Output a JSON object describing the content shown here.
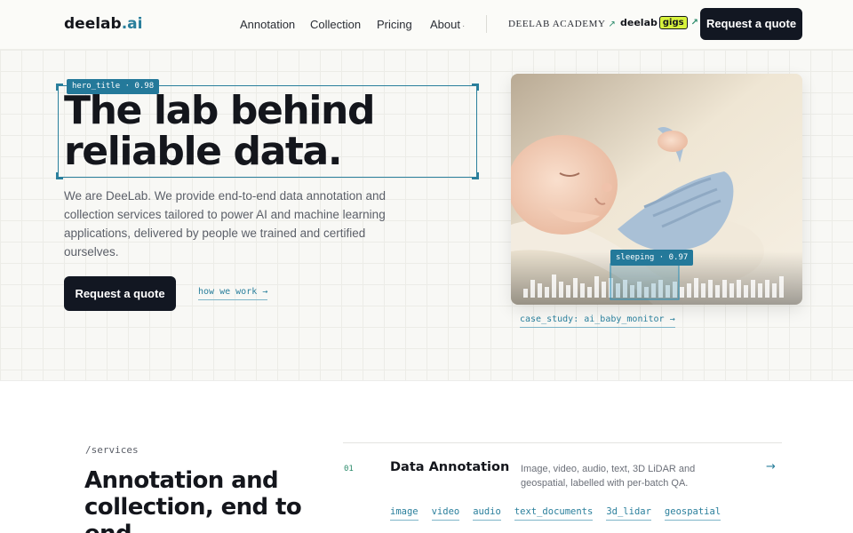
{
  "nav": {
    "logo_main": "deelab",
    "logo_accent": ".ai",
    "links": [
      "Annotation",
      "Collection",
      "Pricing",
      "About"
    ],
    "about_marker": "·",
    "academy": "DEELAB ACADEMY",
    "gigs_prefix": "deelab",
    "gigs_badge": "gigs",
    "external_arrow": "↗",
    "cta": "Request a quote"
  },
  "hero": {
    "title_tag": "hero_title · 0.98",
    "title": "The lab behind reliable data.",
    "description": "We are DeeLab. We provide end-to-end data annotation and collection services tailored to power AI and machine learning applications, delivered by people we trained and certified ourselves.",
    "cta": "Request a quote",
    "how_link": "how we work →",
    "image_tag": "sleeping · 0.97",
    "case_link": "case_study: ai_baby_monitor →"
  },
  "services": {
    "slug": "/services",
    "title": "Annotation and collection, end to end.",
    "items": [
      {
        "number": "01",
        "name": "Data Annotation",
        "description": "Image, video, audio, text, 3D LiDAR and geospatial, labelled with per-batch QA.",
        "arrow": "→",
        "chips": [
          "image",
          "video",
          "audio",
          "text_documents",
          "3d_lidar",
          "geospatial"
        ]
      }
    ]
  },
  "colors": {
    "accent": "#2a7f9c",
    "dark_button": "#121722",
    "gigs_badge": "#d7f23c",
    "mono_green": "#2a8a6a"
  },
  "icons": [
    "external-link-arrow-icon",
    "arrow-right-icon"
  ]
}
